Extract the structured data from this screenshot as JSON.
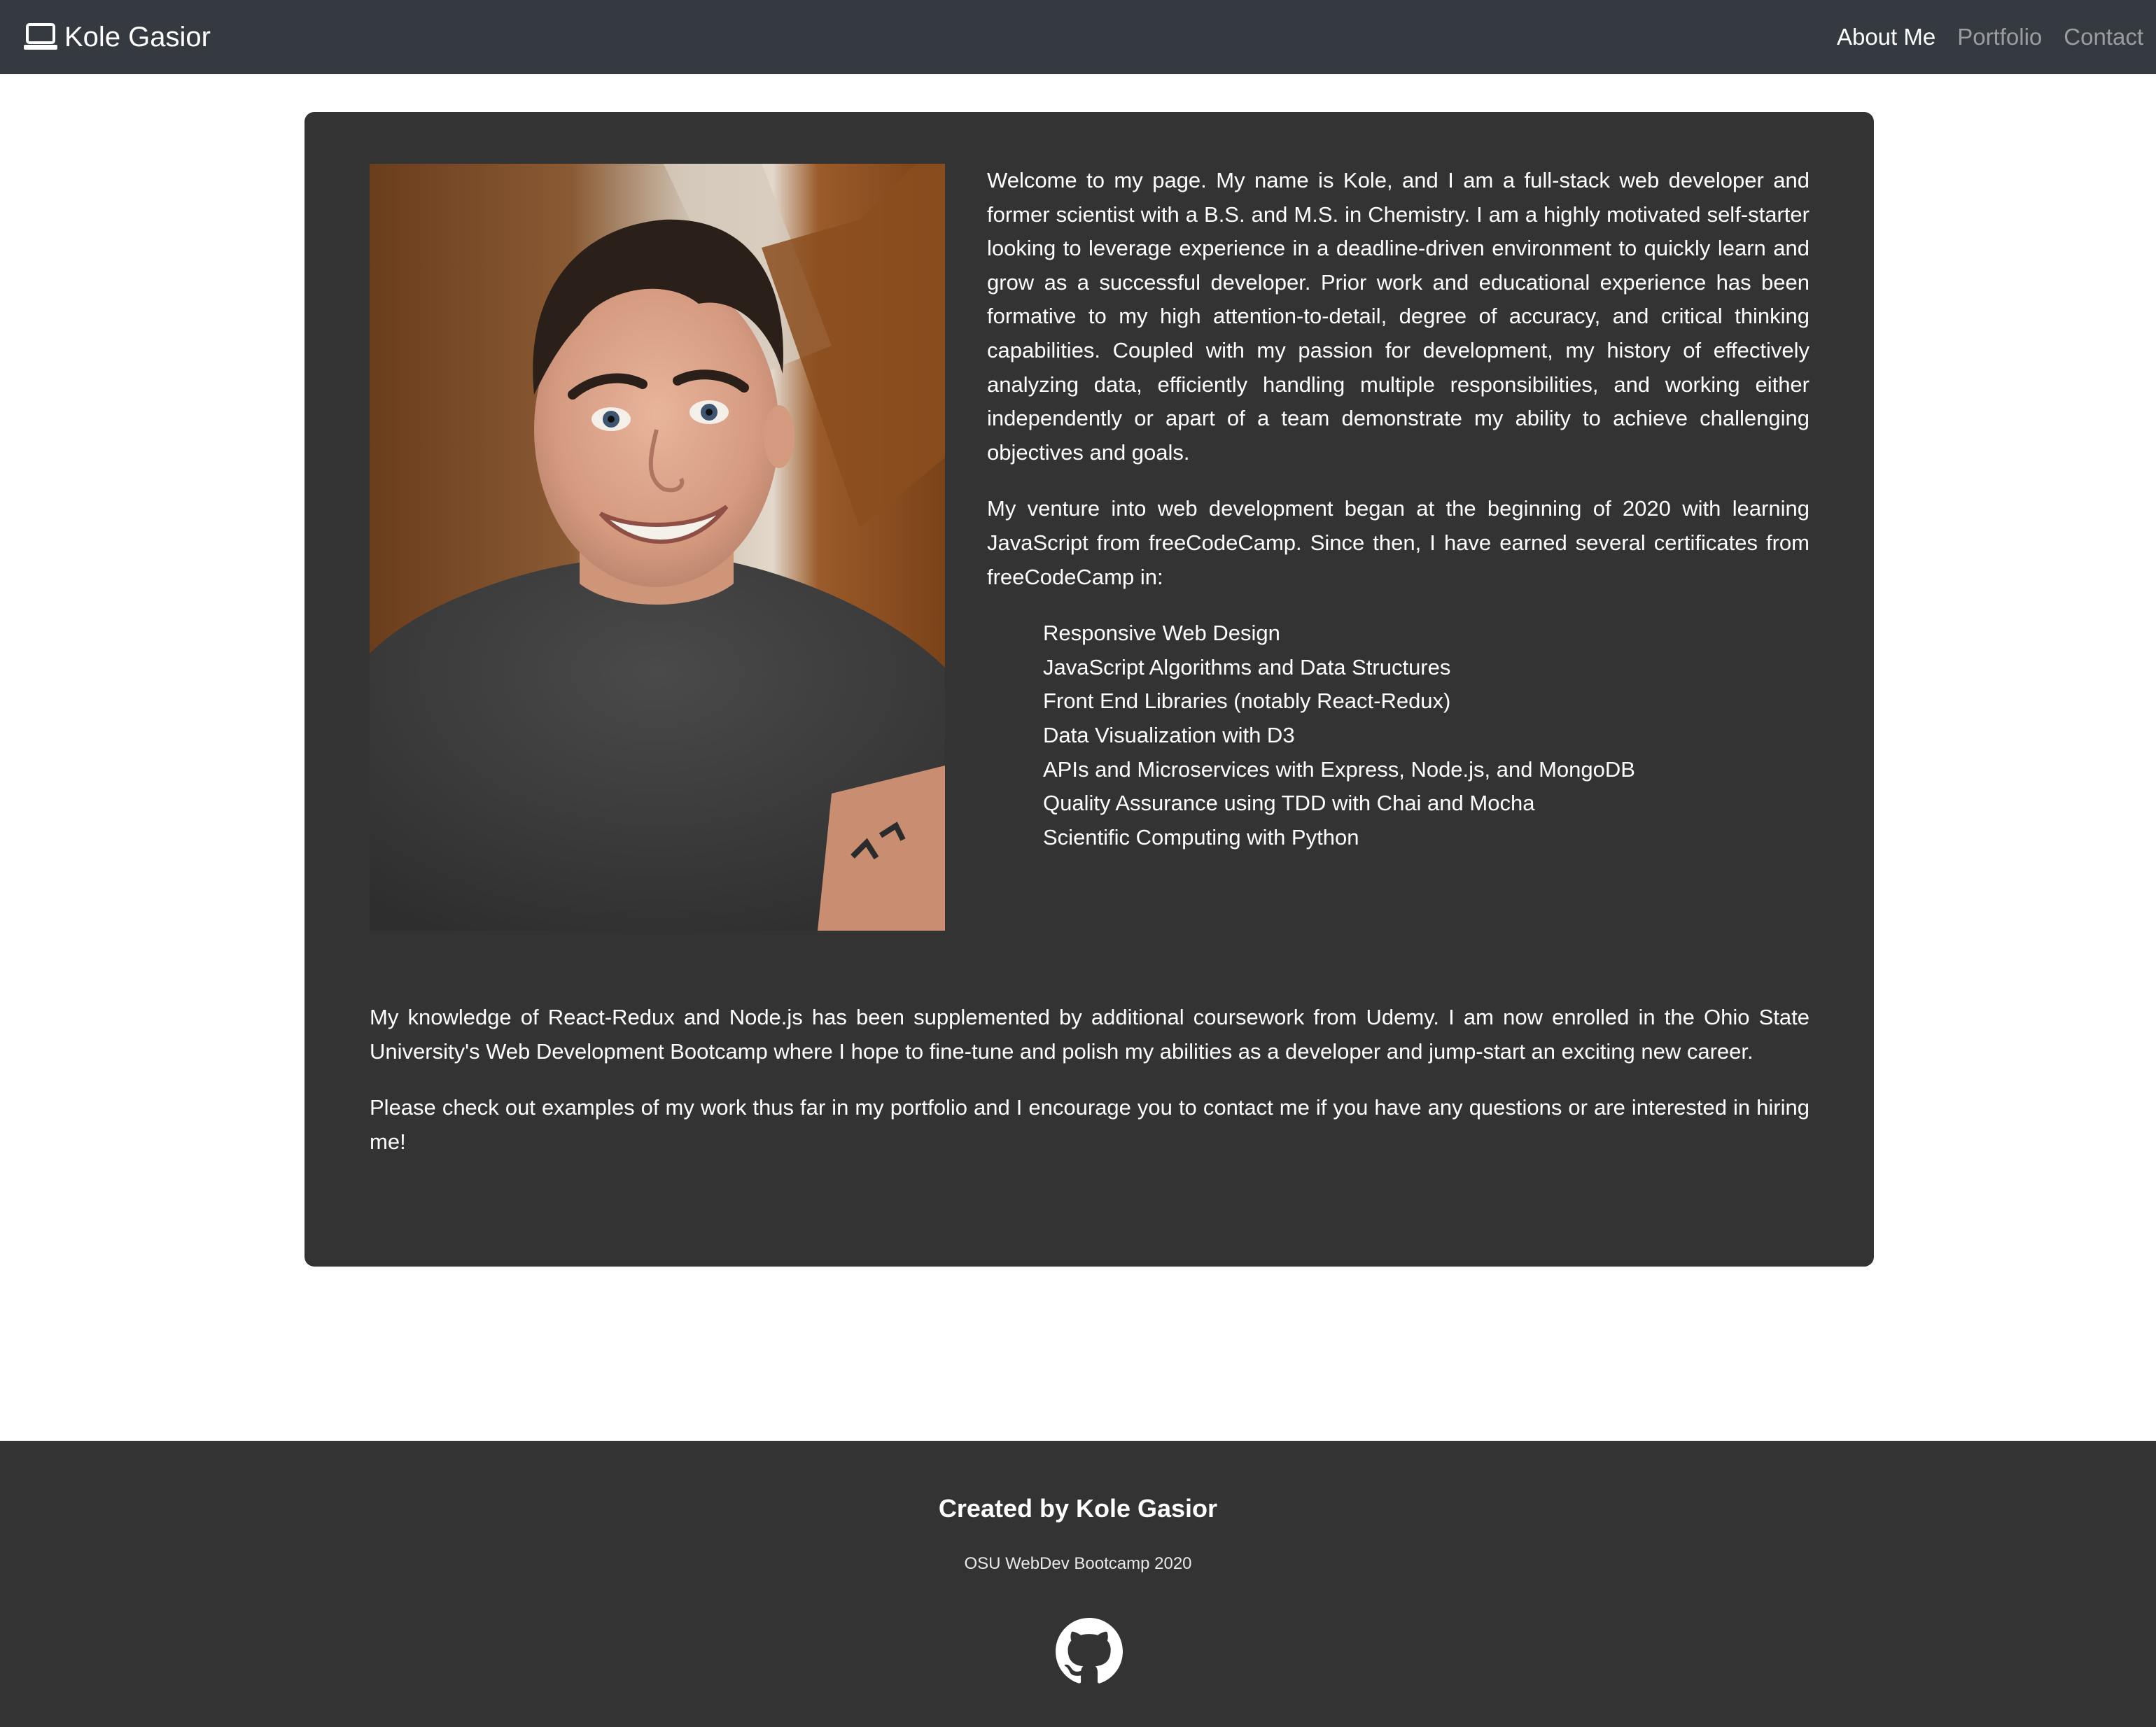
{
  "navbar": {
    "brand_icon": "laptop-icon",
    "brand": "Kole Gasior",
    "links": [
      {
        "label": "About Me",
        "active": true
      },
      {
        "label": "Portfolio",
        "active": false
      },
      {
        "label": "Contact",
        "active": false
      }
    ]
  },
  "about": {
    "photo_alt": "portrait-photo",
    "intro": "Welcome to my page. My name is Kole, and I am a full-stack web developer and former scientist with a B.S. and M.S. in Chemistry. I am a highly motivated self-starter looking to leverage experience in a deadline-driven environment to quickly learn and grow as a successful developer. Prior work and educational experience has been formative to my high attention-to-detail, degree of accuracy, and critical thinking capabilities. Coupled with my passion for development, my history of effectively analyzing data, efficiently handling multiple responsibilities, and working either independently or apart of a team demonstrate my ability to achieve challenging objectives and goals.",
    "venture": "My venture into web development began at the beginning of 2020 with learning JavaScript from freeCodeCamp. Since then, I have earned several certificates from freeCodeCamp in:",
    "certificates": [
      "Responsive Web Design",
      "JavaScript Algorithms and Data Structures",
      "Front End Libraries (notably React-Redux)",
      "Data Visualization with D3",
      "APIs and Microservices with Express, Node.js, and MongoDB",
      "Quality Assurance using TDD with Chai and Mocha",
      "Scientific Computing with Python"
    ],
    "knowledge": "My knowledge of React-Redux and Node.js has been supplemented by additional coursework from Udemy. I am now enrolled in the Ohio State University's Web Development Bootcamp where I hope to fine-tune and polish my abilities as a developer and jump-start an exciting new career.",
    "closing": "Please check out examples of my work thus far in my portfolio and I encourage you to contact me if you have any questions or are interested in hiring me!"
  },
  "footer": {
    "title": "Created by Kole Gasior",
    "subtitle": "OSU WebDev Bootcamp 2020",
    "icon": "github-icon"
  },
  "colors": {
    "navbar_bg": "#343a40",
    "card_bg": "#333333",
    "footer_bg": "#333333",
    "text": "#ffffff"
  }
}
